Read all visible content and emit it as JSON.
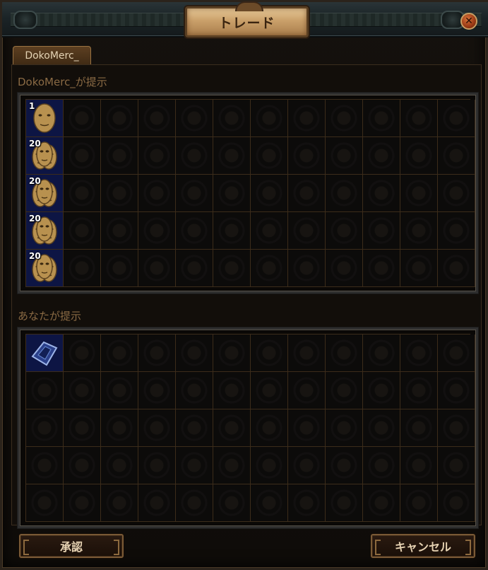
{
  "window": {
    "title": "トレード",
    "close_glyph": "✕"
  },
  "tabs": [
    {
      "label": "DokoMerc_"
    }
  ],
  "their_offer": {
    "label": "DokoMerc_が提示",
    "items": [
      {
        "row": 0,
        "col": 0,
        "quantity": "1",
        "icon": "gold-mask-icon"
      },
      {
        "row": 1,
        "col": 0,
        "quantity": "20",
        "icon": "gold-mask-stack-icon"
      },
      {
        "row": 2,
        "col": 0,
        "quantity": "20",
        "icon": "gold-mask-stack-icon"
      },
      {
        "row": 3,
        "col": 0,
        "quantity": "20",
        "icon": "gold-mask-stack-icon"
      },
      {
        "row": 4,
        "col": 0,
        "quantity": "20",
        "icon": "gold-mask-stack-icon"
      }
    ]
  },
  "your_offer": {
    "label": "あなたが提示",
    "items": [
      {
        "row": 0,
        "col": 0,
        "quantity": "",
        "icon": "blue-map-icon"
      }
    ]
  },
  "buttons": {
    "accept_label": "承認",
    "cancel_label": "キャンセル"
  },
  "colors": {
    "occupied_cell": "#0d1544",
    "gold": "#caa06a",
    "label_text": "#8a6a44"
  }
}
